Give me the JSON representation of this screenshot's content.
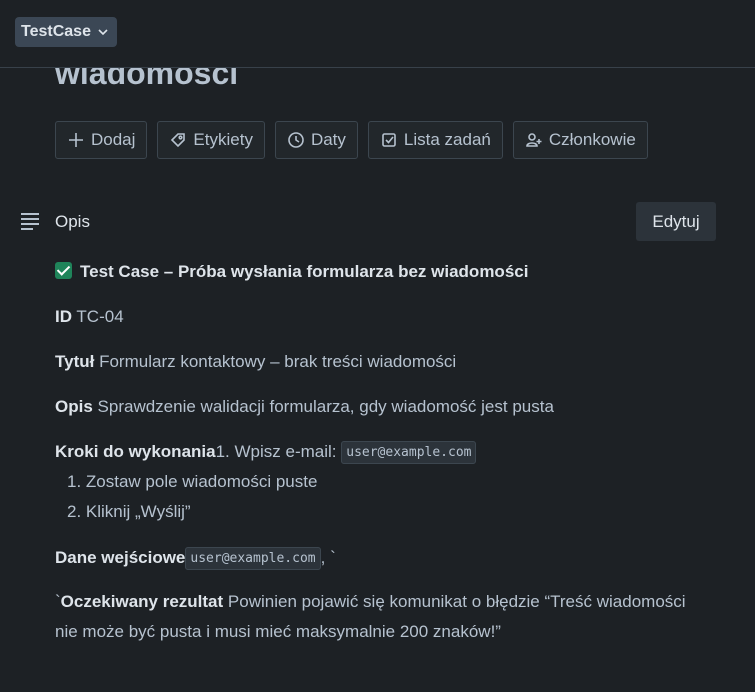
{
  "header": {
    "tag_label": "TestCase",
    "tag_icon": "chevron-down-icon",
    "title": "wiadomości"
  },
  "actions": [
    {
      "label": "Dodaj",
      "icon": "plus-icon"
    },
    {
      "label": "Etykiety",
      "icon": "tag-icon"
    },
    {
      "label": "Daty",
      "icon": "clock-icon"
    },
    {
      "label": "Lista zadań",
      "icon": "checklist-icon"
    },
    {
      "label": "Członkowie",
      "icon": "add-member-icon"
    }
  ],
  "description": {
    "section_label": "Opis",
    "edit_label": "Edytuj",
    "heading": "Test Case  – Próba wysłania formularza bez wiadomości",
    "id_label": "ID",
    "id_value": "TC-04",
    "title_label": "Tytuł",
    "title_value": "Formularz kontaktowy – brak treści wiadomości",
    "opis_label": "Opis",
    "opis_value": "Sprawdzenie walidacji formularza, gdy wiadomość jest pusta",
    "steps_label": "Kroki do wykonania",
    "step1_prefix": "1. Wpisz e-mail:",
    "step1_code": "user@example.com",
    "step2": "1. Zostaw pole wiadomości puste",
    "step3": "2. Kliknij „Wyślij”",
    "input_label": "Dane wejściowe",
    "input_code": "user@example.com",
    "input_suffix": ", `",
    "expected_prefix": "`",
    "expected_label": "Oczekiwany rezultat",
    "expected_value_line1": "Powinien pojawić się komunikat o błędzie “Treść wiadomości",
    "expected_value_line2": "nie może być pusta i musi mieć maksymalnie 200 znaków!”"
  },
  "colors": {
    "background": "#1d2125",
    "button_border": "#3c464f",
    "check_green": "#1f845a"
  }
}
